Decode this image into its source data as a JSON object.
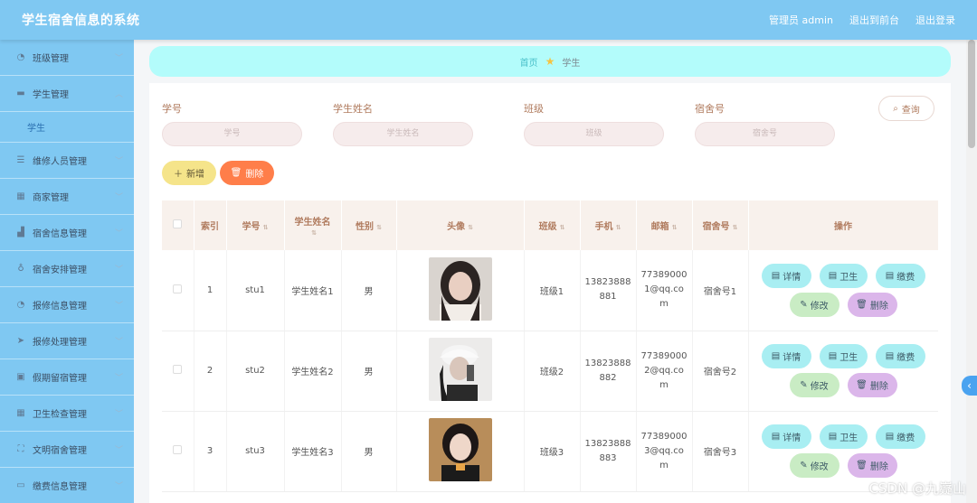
{
  "header": {
    "title": "学生宿舍信息的系统",
    "admin_label": "管理员 admin",
    "front_link": "退出到前台",
    "logout_link": "退出登录"
  },
  "sidebar": {
    "items": [
      {
        "label": "班级管理",
        "icon": "clock-icon"
      },
      {
        "label": "学生管理",
        "icon": "chat-icon"
      },
      {
        "label": "维修人员管理",
        "icon": "list-icon"
      },
      {
        "label": "商家管理",
        "icon": "grid-icon"
      },
      {
        "label": "宿舍信息管理",
        "icon": "thumb-icon"
      },
      {
        "label": "宿舍安排管理",
        "icon": "mic-icon"
      },
      {
        "label": "报修信息管理",
        "icon": "clock-icon"
      },
      {
        "label": "报修处理管理",
        "icon": "send-icon"
      },
      {
        "label": "假期留宿管理",
        "icon": "edit-icon"
      },
      {
        "label": "卫生检查管理",
        "icon": "apps-icon"
      },
      {
        "label": "文明宿舍管理",
        "icon": "frame-icon"
      },
      {
        "label": "缴费信息管理",
        "icon": "card-icon"
      }
    ],
    "sub_item": "学生"
  },
  "breadcrumb": {
    "home": "首页",
    "current": "学生"
  },
  "search": {
    "fields": [
      {
        "label": "学号",
        "placeholder": "学号"
      },
      {
        "label": "学生姓名",
        "placeholder": "学生姓名"
      },
      {
        "label": "班级",
        "placeholder": "班级"
      },
      {
        "label": "宿舍号",
        "placeholder": "宿舍号"
      }
    ],
    "query_label": "查询"
  },
  "toolbar": {
    "add_label": "新增",
    "delete_label": "删除"
  },
  "table": {
    "headers": [
      "索引",
      "学号",
      "学生姓名",
      "性别",
      "头像",
      "班级",
      "手机",
      "邮箱",
      "宿舍号",
      "操作"
    ],
    "rows": [
      {
        "index": "1",
        "no": "stu1",
        "name": "学生姓名1",
        "gender": "男",
        "class": "班级1",
        "phone": "13823888881",
        "email": "773890001@qq.com",
        "room": "宿舍号1"
      },
      {
        "index": "2",
        "no": "stu2",
        "name": "学生姓名2",
        "gender": "男",
        "class": "班级2",
        "phone": "13823888882",
        "email": "773890002@qq.com",
        "room": "宿舍号2"
      },
      {
        "index": "3",
        "no": "stu3",
        "name": "学生姓名3",
        "gender": "男",
        "class": "班级3",
        "phone": "13823888883",
        "email": "773890003@qq.com",
        "room": "宿舍号3"
      }
    ],
    "actions": {
      "detail": "详情",
      "health": "卫生",
      "fee": "缴费",
      "edit": "修改",
      "remove": "删除"
    }
  },
  "watermark": "CSDN @九嶷山"
}
